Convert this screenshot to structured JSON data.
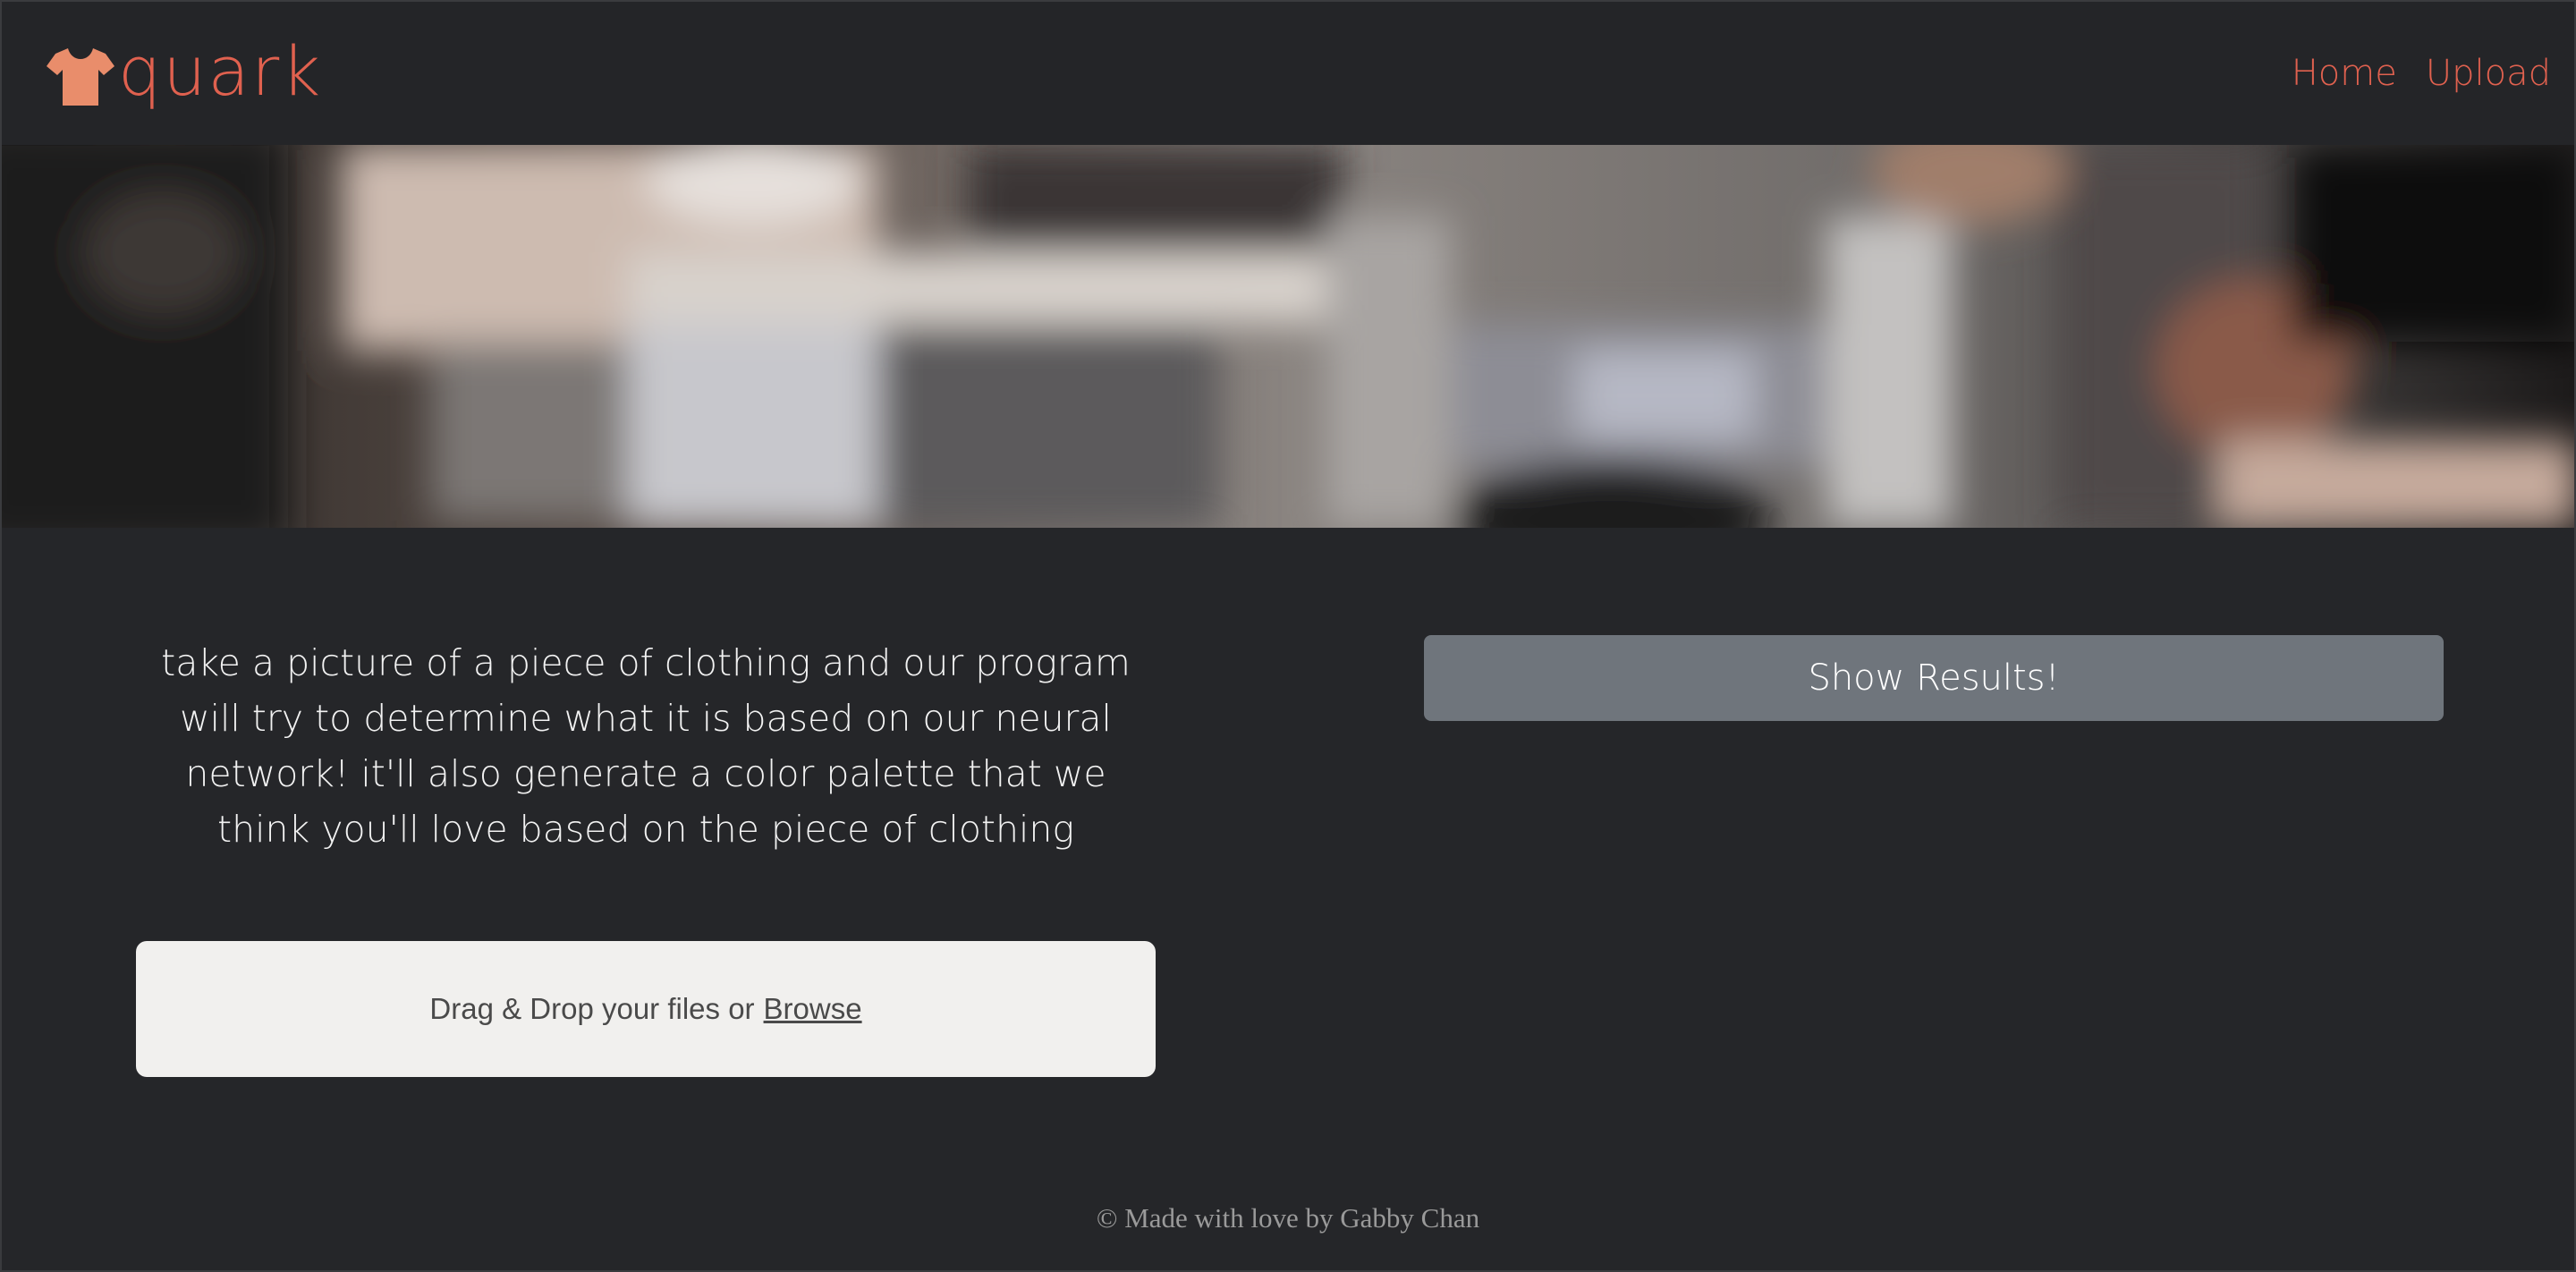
{
  "header": {
    "brand": "quark",
    "brand_icon": "tshirt-icon",
    "brand_color": "#e0614f",
    "icon_color": "#e98d6b",
    "nav": [
      {
        "label": "Home"
      },
      {
        "label": "Upload"
      }
    ]
  },
  "hero": {
    "image": "blurred-workspace-photo"
  },
  "main": {
    "intro_text": "take a picture of a piece of clothing and our program will try to determine what it is based on our neural network! it'll also generate a color palette that we think you'll love based on the piece of clothing",
    "dropzone": {
      "prompt": "Drag & Drop your files or",
      "browse_label": "Browse"
    },
    "show_results_label": "Show Results!"
  },
  "footer": {
    "text": "© Made with love by Gabby Chan"
  },
  "colors": {
    "background": "#252629",
    "accent": "#e0614f",
    "button": "#6f757c",
    "dropzone": "#f1f0ee"
  }
}
